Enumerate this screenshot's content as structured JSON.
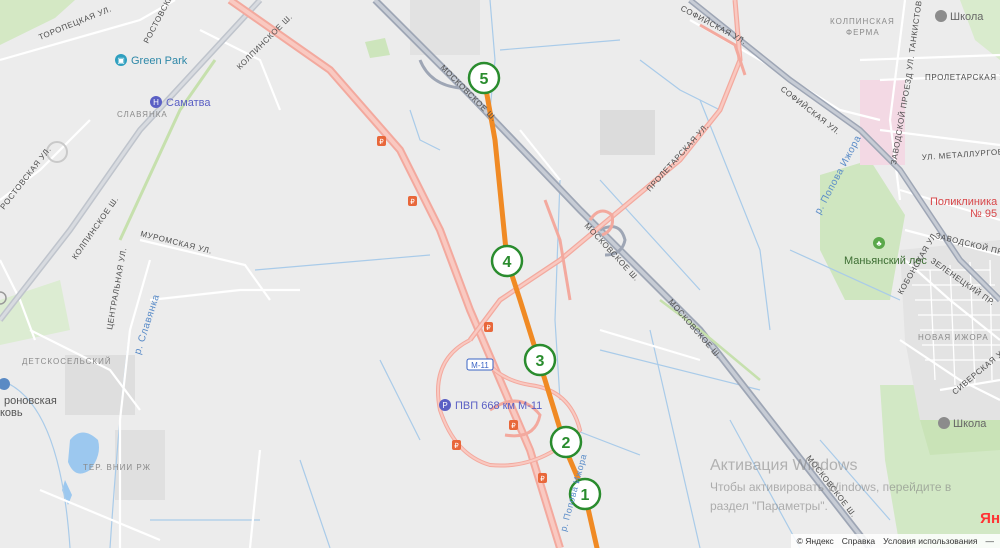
{
  "map": {
    "districts": {
      "slavyanka": "СЛАВЯНКА",
      "detskoselsky": "ДЕТСКОСЕЛЬСКИЙ",
      "novaya_izhora": "НОВАЯ ИЖОРА",
      "kolpinskaya_ferma": "КОЛПИНСКАЯ\nФЕРМА",
      "ter_vnii_rzh": "ТЕР. ВНИИ РЖ"
    },
    "streets": {
      "toropetskaya": "ТОРОПЕЦКАЯ УЛ.",
      "rostovskaya_top": "РОСТОВСКАЯ УЛ.",
      "rostovskaya_left": "РОСТОВСКАЯ УЛ.",
      "kolpinskoe_top": "КОЛПИНСКОЕ Ш.",
      "kolpinskoe_left": "КОЛПИНСКОЕ Ш.",
      "muromskaya": "МУРОМСКАЯ УЛ.",
      "tsentralnaya": "ЦЕНТРАЛЬНАЯ УЛ.",
      "moskovskoe_1": "МОСКОВСКОЕ Ш.",
      "moskovskoe_2": "МОСКОВСКОЕ Ш.",
      "moskovskoe_3": "МОСКОВСКОЕ Ш.",
      "moskovskoe_4": "МОСКОВСКОЕ Ш.",
      "sofiyskaya_top": "СОФИЙСКАЯ УЛ.",
      "sofiyskaya": "СОФИЙСКАЯ УЛ.",
      "proletarskaya_center": "ПРОЛЕТАРСКАЯ УЛ.",
      "proletarskaya_right": "ПРОЛЕТАРСКАЯ УЛ.",
      "tankistov": "УЛ. ТАНКИСТОВ",
      "zavodskoy_proezd": "ЗАВОДСКОЙ ПРОЕЗД",
      "metallurgov": "УЛ. МЕТАЛЛУРГОВ",
      "zavodskoy_pr": "ЗАВОДСКОЙ ПРО",
      "zelenetsky": "ЗЕЛЕНЕЦКИЙ ПР.",
      "kobonskaya": "КОБОНСКАЯ УЛ.",
      "sivergskaya": "СИВЕРСКАЯ УЛ.",
      "m11": "М-11"
    },
    "rivers": {
      "slavyanka": "р. Славянка",
      "popova_izhora": "р. Попова Ижора",
      "popova_izhora_bottom": "р. Попова Ижора"
    },
    "pois": {
      "green_park": "Green Park",
      "samatva": "Саматва",
      "pvp": "ПВП 668 км М-11",
      "poliklinika": "Поликлиника\n№ 95",
      "manyansky_les": "Маньянский лес",
      "shkola_top": "Школа",
      "shkola_bottom": "Школа",
      "church_partial": "роновская\nковь"
    },
    "markers": [
      "1",
      "2",
      "3",
      "4",
      "5"
    ],
    "route_color": "#f08a24",
    "marker_color": "#2a8c2e"
  },
  "watermark": {
    "line1": "Активация Windows",
    "line2": "Чтобы активировать Windows, перейдите в",
    "line3": "раздел \"Параметры\"."
  },
  "attribution": {
    "copyright": "© Яндекс",
    "help": "Справка",
    "terms": "Условия использования",
    "brand": "Ян"
  }
}
